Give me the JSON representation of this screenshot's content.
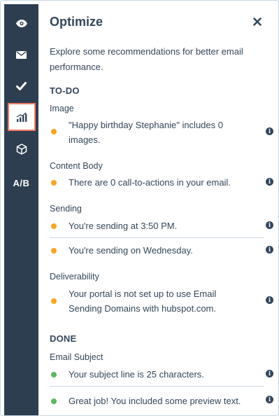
{
  "panel": {
    "title": "Optimize",
    "intro": "Explore some recommendations for better email performance."
  },
  "rail": {
    "ab_label": "A/B",
    "icons": [
      "eye-icon",
      "envelope-icon",
      "checkmark-icon",
      "chart-icon",
      "cube-icon"
    ]
  },
  "colors": {
    "rail": "#2d3e50",
    "warning_dot": "#f5a623",
    "success_dot": "#5cb85c",
    "active_outline": "#ef7c66"
  },
  "todo": {
    "heading": "TO-DO",
    "image_label": "Image",
    "image_item": "\"Happy birthday Stephanie\" includes 0 images.",
    "content_label": "Content Body",
    "content_item": "There are 0 call-to-actions in your email.",
    "sending_label": "Sending",
    "sending_item_1": "You're sending at 3:50 PM.",
    "sending_item_2": "You're sending on Wednesday.",
    "deliver_label": "Deliverability",
    "deliver_item": "Your portal is not set up to use Email Sending Domains with hubspot.com."
  },
  "done": {
    "heading": "DONE",
    "subject_label": "Email Subject",
    "subject_item": "Your subject line is 25 characters.",
    "preview_item": "Great job! You included some preview text."
  }
}
